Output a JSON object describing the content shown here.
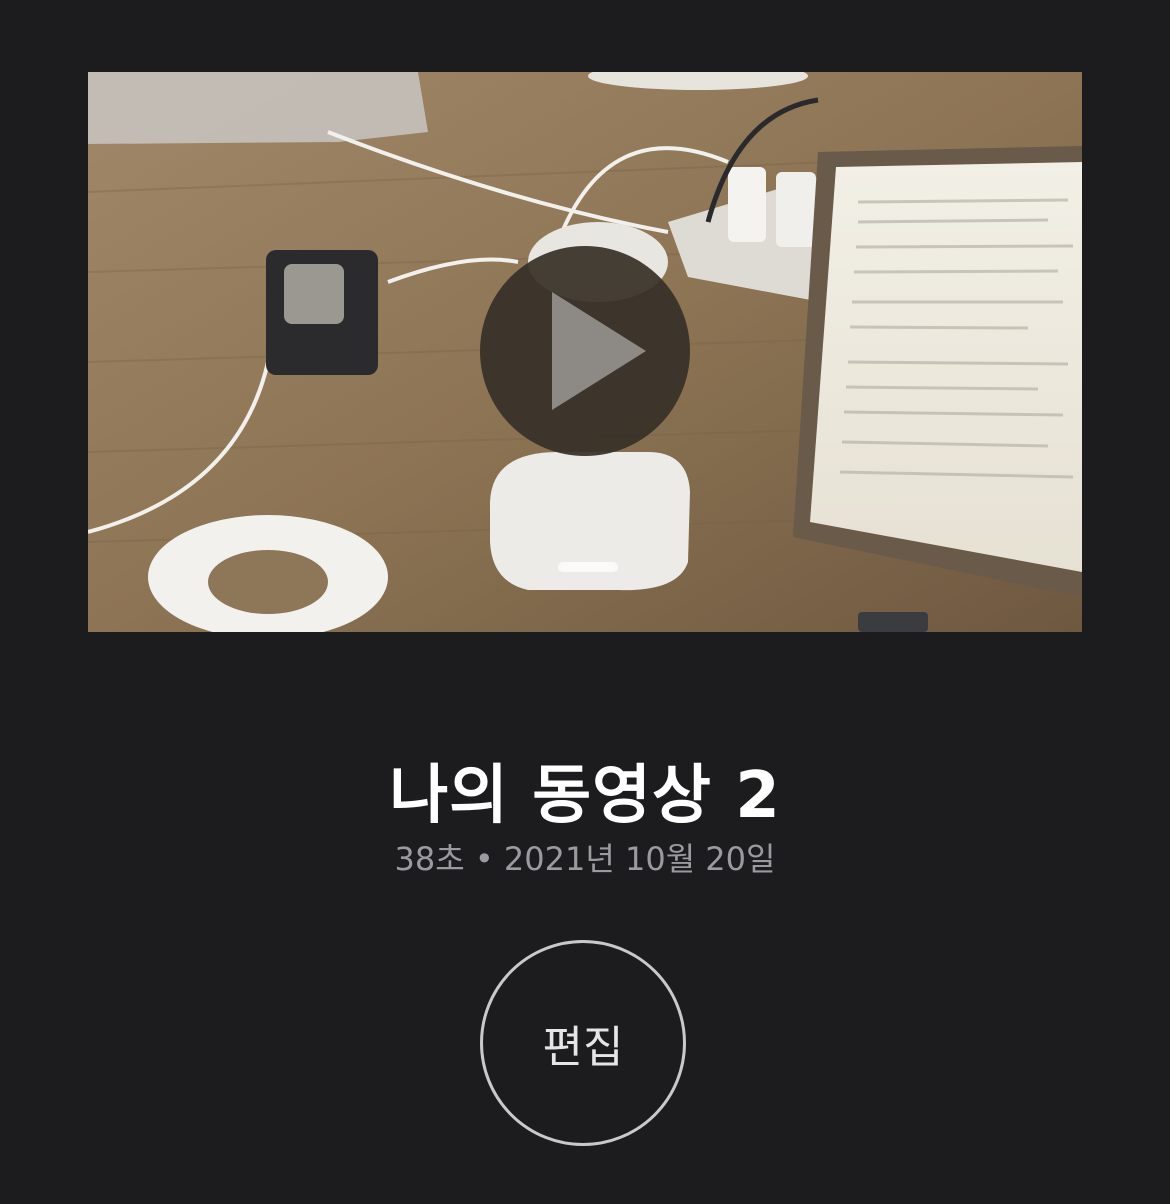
{
  "video": {
    "title": "나의 동영상 2",
    "duration": "38초",
    "separator": "•",
    "date": "2021년 10월 20일",
    "play_icon": "play-icon"
  },
  "actions": {
    "edit_label": "편집"
  },
  "colors": {
    "background": "#1c1c1e",
    "title": "#ffffff",
    "meta": "#9a9a9f",
    "edit_border": "#c9c9cc"
  }
}
